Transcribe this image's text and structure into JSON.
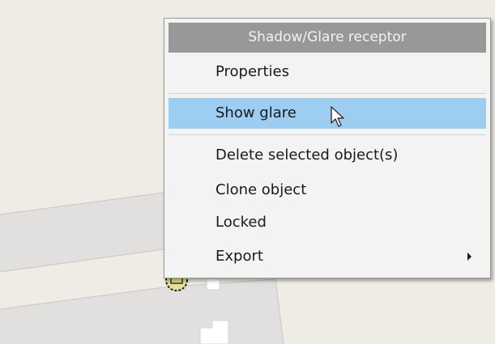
{
  "menu": {
    "title": "Shadow/Glare receptor",
    "items": [
      {
        "label": "Properties"
      },
      {
        "label": "Show glare",
        "highlighted": true
      },
      {
        "label": "Delete selected object(s)"
      },
      {
        "label": "Clone object"
      },
      {
        "label": "Locked"
      },
      {
        "label": "Export",
        "has_submenu": true
      }
    ],
    "highlight_color": "#9dcdf0",
    "title_bar_color": "#989898"
  },
  "map": {
    "background_color": "#efece6",
    "road_color": "#e2e0df",
    "marker_icon": "receptor-marker-icon"
  },
  "cursor_icon": "arrow-pointer-icon"
}
